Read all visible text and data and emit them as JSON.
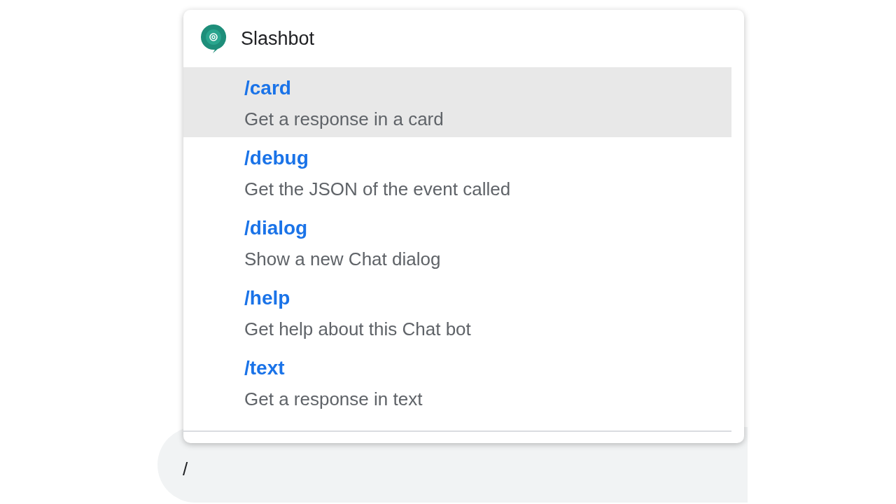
{
  "menu": {
    "title": "Slashbot",
    "commands": [
      {
        "command": "/card",
        "description": "Get a response in a card",
        "selected": true
      },
      {
        "command": "/debug",
        "description": "Get the JSON of the event called",
        "selected": false
      },
      {
        "command": "/dialog",
        "description": "Show a new Chat dialog",
        "selected": false
      },
      {
        "command": "/help",
        "description": "Get help about this Chat bot",
        "selected": false
      },
      {
        "command": "/text",
        "description": "Get a response in text",
        "selected": false
      }
    ]
  },
  "message_field": {
    "value": "/"
  }
}
